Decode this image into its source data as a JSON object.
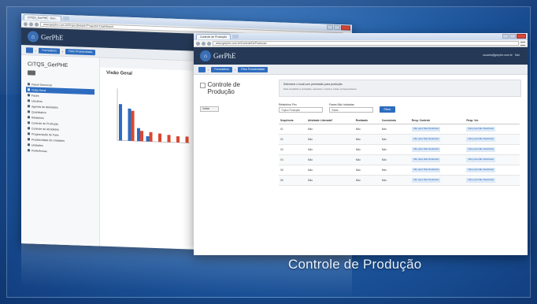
{
  "caption": "Controle de Produção",
  "back_window": {
    "tab_title": "CITQS_GerPHE - Gen...",
    "url": "www.gerphe.com.br/ProjectDetails?ProjectId=DashBoard",
    "logo_text": "GerPhE",
    "crumbs": [
      "Formulários",
      "Filtro Produtividade"
    ],
    "sidebar_title": "CITQS_GerPHE",
    "sidebar_items": [
      {
        "label": "Painel Gerencial",
        "active": false
      },
      {
        "label": "Visão Geral",
        "active": true
      },
      {
        "label": "Fases",
        "active": false
      },
      {
        "label": "Usuários",
        "active": false
      },
      {
        "label": "Agenda de Atividades",
        "active": false
      },
      {
        "label": "Quantitativo",
        "active": false
      },
      {
        "label": "Relatórios",
        "active": false
      },
      {
        "label": "Controle de Produção",
        "active": false
      },
      {
        "label": "Controle de Atividades",
        "active": false
      },
      {
        "label": "Programação de Fase",
        "active": false
      },
      {
        "label": "Produtividade de Unidades",
        "active": false
      },
      {
        "label": "Unidades",
        "active": false
      },
      {
        "label": "Preferências",
        "active": false
      }
    ],
    "main_title": "Visão Geral",
    "chart_data": {
      "type": "bar",
      "categories": [
        "",
        "",
        "",
        "",
        "",
        "",
        "",
        ""
      ],
      "series": [
        {
          "values": [
            70,
            62,
            25,
            10,
            0,
            0,
            0,
            0
          ]
        },
        {
          "values": [
            0,
            58,
            20,
            18,
            16,
            14,
            12,
            12
          ]
        }
      ],
      "ylim": [
        0,
        100
      ],
      "colors": [
        "#2d6cbf",
        "#d9472f"
      ]
    }
  },
  "front_window": {
    "tab_title": "Controle de Produção",
    "url": "www.gerphe.com.br/ControleDeProducao",
    "logo_text": "GerPhE",
    "user_info": "usuario@gerphe.com.br",
    "logout_label": "Sair",
    "crumbs": [
      "Formulários",
      "Filtro Produtividade"
    ],
    "page_title": "Controle de Produção",
    "back_button": "Voltar",
    "alert_title": "Selecione o local com permissão para produção",
    "alert_text": "Para visualizar a produção, selecione o local e a fase correspondente.",
    "filter1_label": "Relatórios Fim",
    "filter1_value": "Tópico Produção",
    "filter2_label": "Fases Não Iniciadas",
    "filter2_value": "Todas",
    "filter_button": "Filtrar",
    "columns": [
      "Sequência",
      "Atividade Liberada?",
      "Realizado",
      "Concluindo",
      "Resp. Controle",
      "Resp. Ver."
    ],
    "rows": [
      [
        "01",
        "Não",
        "Não",
        "Não",
        "Vão para Não Realizado",
        "Vão para Não Realizado"
      ],
      [
        "02",
        "Não",
        "Não",
        "Não",
        "Vão para Não Realizado",
        "Vão para Não Realizado"
      ],
      [
        "03",
        "Não",
        "Não",
        "Não",
        "Vão para Não Realizado",
        "Vão para Não Realizado"
      ],
      [
        "04",
        "Não",
        "Não",
        "Não",
        "Vão para Não Realizado",
        "Vão para Não Realizado"
      ],
      [
        "05",
        "Não",
        "Não",
        "Não",
        "Vão para Não Realizado",
        "Vão para Não Realizado"
      ],
      [
        "06",
        "Não",
        "Não",
        "Não",
        "Vão para Não Realizado",
        "Vão para Não Realizado"
      ]
    ]
  }
}
